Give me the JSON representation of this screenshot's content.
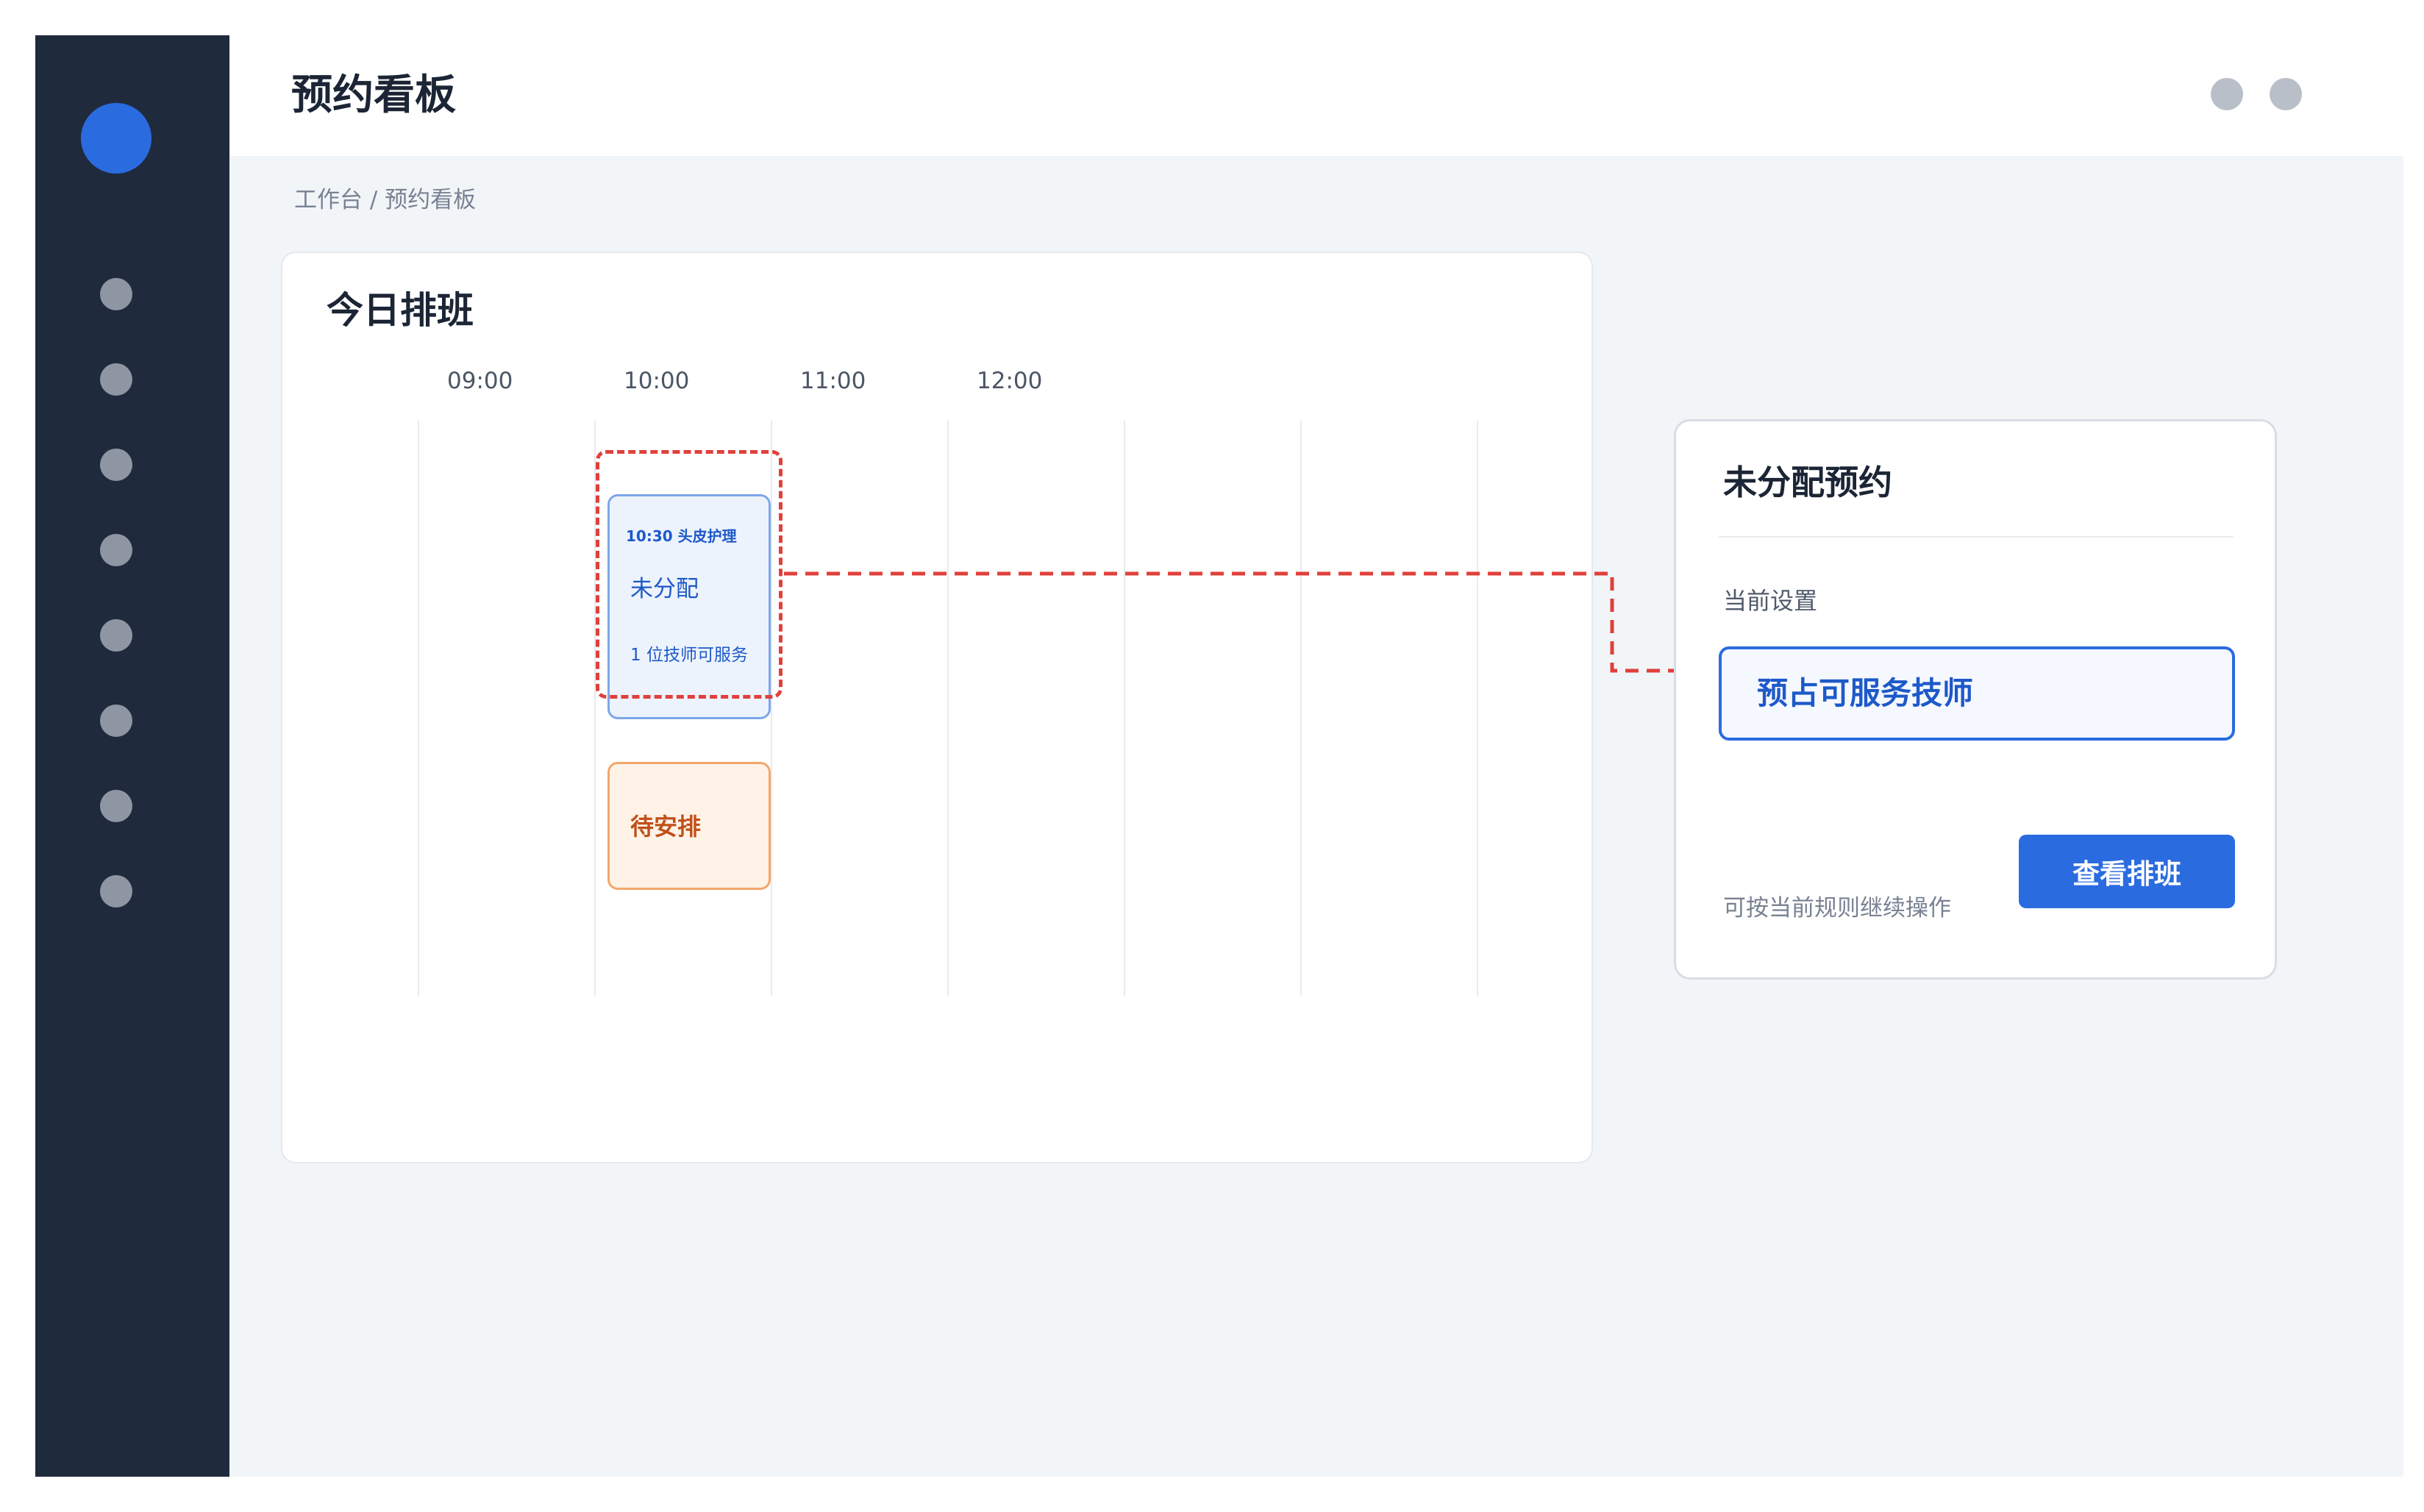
{
  "header": {
    "title": "预约看板"
  },
  "breadcrumb": "工作台 / 预约看板",
  "schedule": {
    "title": "今日排班",
    "time_labels": [
      "09:00",
      "10:00",
      "11:00",
      "12:00"
    ],
    "events": [
      {
        "time_service": "10:30 头皮护理",
        "status": "未分配",
        "note": "1 位技师可服务"
      },
      {
        "status": "待安排"
      }
    ]
  },
  "panel": {
    "title": "未分配预约",
    "setting_label": "当前设置",
    "setting_value": "预占可服务技师",
    "hint": "可按当前规则继续操作",
    "button_label": "查看排班"
  },
  "colors": {
    "sidebar_bg": "#1f2a3c",
    "accent": "#2a6be0",
    "highlight": "#e0403b",
    "event_blue": "#edf3fd",
    "event_orange": "#fff3e8"
  },
  "icons": {
    "logo": "app-logo-circle",
    "nav": [
      "nav-icon",
      "nav-icon",
      "nav-icon",
      "nav-icon",
      "nav-icon",
      "nav-icon",
      "nav-icon",
      "nav-icon"
    ],
    "header": [
      "notification-icon",
      "user-avatar-icon"
    ]
  }
}
